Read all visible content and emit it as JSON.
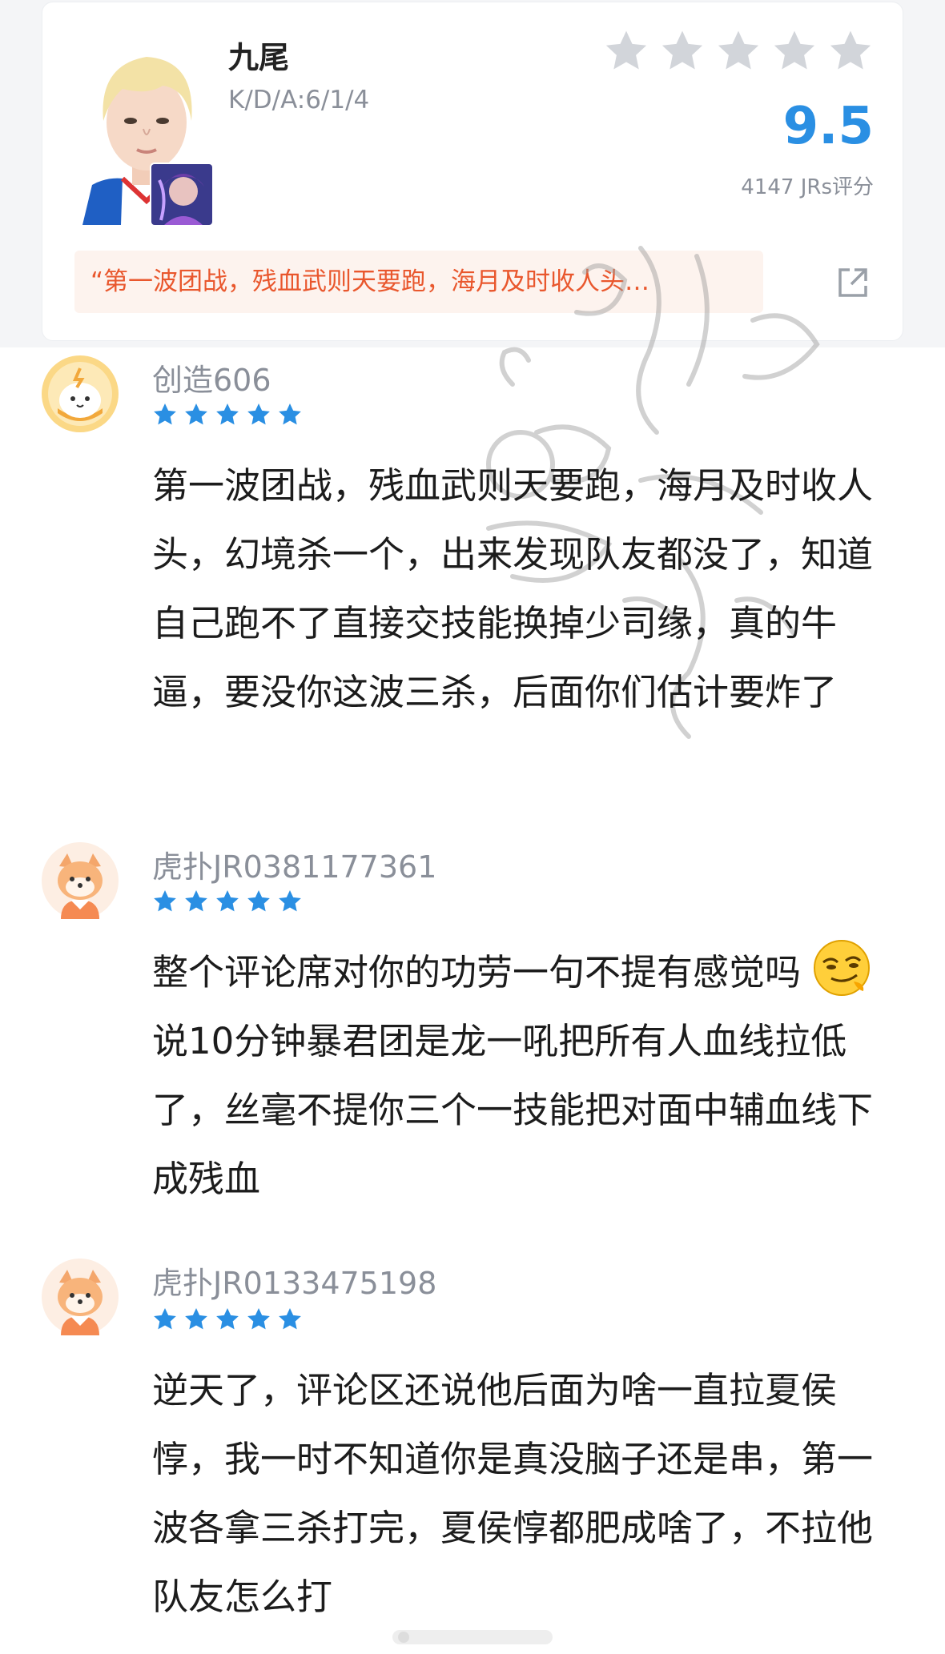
{
  "player": {
    "name": "九尾",
    "kda": "K/D/A:6/1/4",
    "stars_filled": 0,
    "stars_total": 5,
    "score": "9.5",
    "rating_count": "4147 JRs评分",
    "quote": "“第一波团战，残血武则天要跑，海月及时收人头…",
    "star_color": "#d2d5da"
  },
  "colors": {
    "accent_blue": "#2a8fe3",
    "quote_text": "#e9572d",
    "quote_bg": "#fdf3ee",
    "star_blue": "#2a8fe3"
  },
  "comments": [
    {
      "user": "创造606",
      "stars": 5,
      "avatar": "cute-bun-avatar",
      "text": "第一波团战，残血武则天要跑，海月及时收人头，幻境杀一个，出来发现队友都没了，知道自己跑不了直接交技能换掉少司缘，真的牛逼，要没你这波三杀，后面你们估计要炸了"
    },
    {
      "user": "虎扑JR0381177361",
      "stars": 5,
      "avatar": "fox-avatar",
      "emoji": "smirk-emoji",
      "text_before": "整个评论席对你的功劳一句不提有感觉吗",
      "text_after": "说10分钟暴君团是龙一吼把所有人血线拉低了，丝毫不提你三个一技能把对面中辅血线下成残血"
    },
    {
      "user": "虎扑JR0133475198",
      "stars": 5,
      "avatar": "fox-avatar",
      "text": "逆天了，评论区还说他后面为啥一直拉夏侯惇，我一时不知道你是真没脑子还是串，第一波各拿三杀打完，夏侯惇都肥成啥了，不拉他队友怎么打"
    }
  ]
}
